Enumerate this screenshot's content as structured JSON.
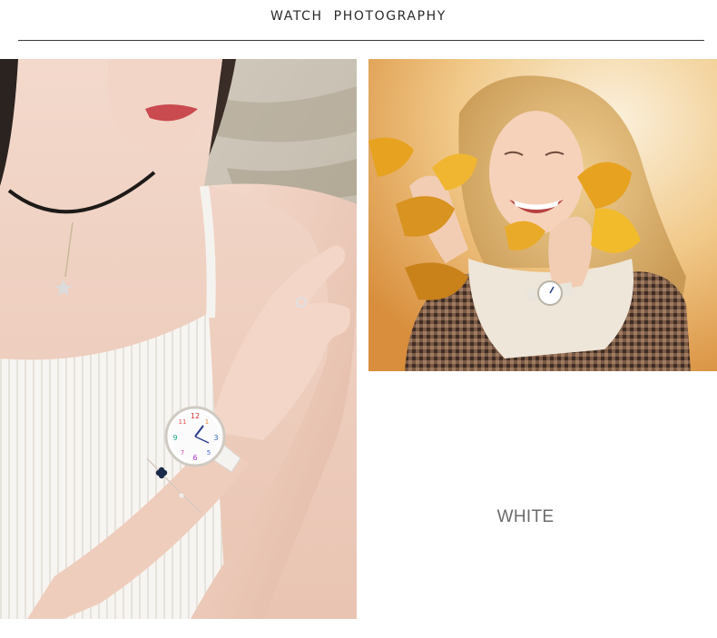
{
  "header": {
    "title_word_1": "WATCH",
    "title_word_2": "PHOTOGRAPHY"
  },
  "photos": {
    "left": {
      "description": "Woman in white ribbed camisole wearing a colorful-numeral white watch, choker necklace and clover bracelet"
    },
    "right": {
      "description": "Smiling blonde woman holding yellow autumn leaves, wearing houndstooth coat and white watch"
    }
  },
  "product": {
    "color_label": "WHITE"
  },
  "colors": {
    "accent": "#2a2a2a",
    "label": "#6b6b6b",
    "background": "#ffffff"
  }
}
